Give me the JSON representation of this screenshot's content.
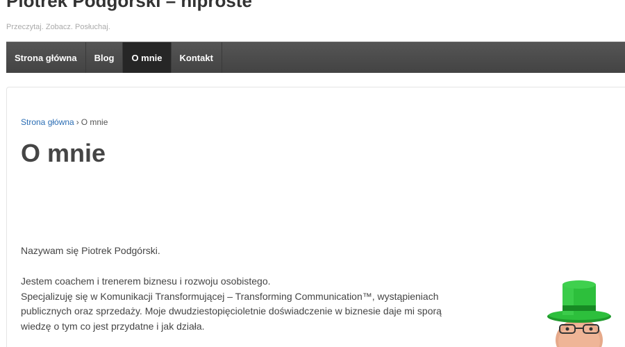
{
  "header": {
    "title": "Piotrek Podgórski – hiproste",
    "tagline": "Przeczytaj. Zobacz. Posłuchaj."
  },
  "nav": {
    "items": [
      {
        "label": "Strona główna",
        "active": false
      },
      {
        "label": "Blog",
        "active": false
      },
      {
        "label": "O mnie",
        "active": true
      },
      {
        "label": "Kontakt",
        "active": false
      }
    ]
  },
  "breadcrumb": {
    "home": "Strona główna",
    "separator": "›",
    "current": "O mnie"
  },
  "page": {
    "title": "O mnie",
    "intro": "Nazywam się Piotrek Podgórski.",
    "line1": "Jestem coachem i trenerem biznesu i rozwoju osobistego.",
    "line2": "Specjalizuję się w Komunikacji Transformującej – Transforming Communication™, wystąpieniach publicznych oraz sprzedaży. Moje dwudziestopięcioletnie doświadczenie w biznesie daje mi sporą wiedzę o tym co jest przydatne i jak działa."
  },
  "colors": {
    "nav_bg": "#4a4a4a",
    "nav_active": "#262626",
    "link": "#2a6db4",
    "hat": "#2dbf3c"
  }
}
